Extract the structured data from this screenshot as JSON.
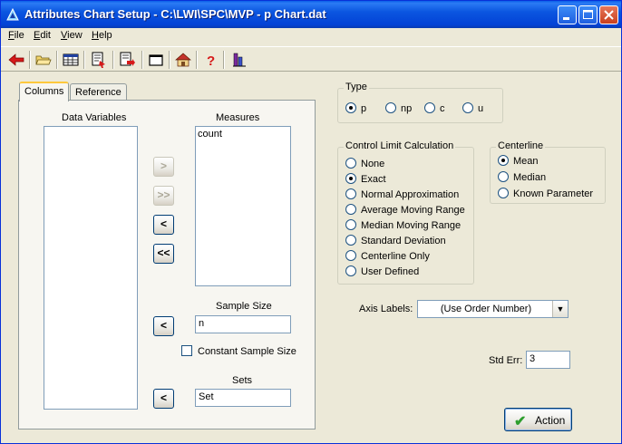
{
  "window": {
    "title": "Attributes Chart Setup - C:\\LWI\\SPC\\MVP - p Chart.dat"
  },
  "menu": [
    {
      "label": "File",
      "hotkey": "F",
      "rest": "ile"
    },
    {
      "label": "Edit",
      "hotkey": "E",
      "rest": "dit"
    },
    {
      "label": "View",
      "hotkey": "V",
      "rest": "iew"
    },
    {
      "label": "Help",
      "hotkey": "H",
      "rest": "elp"
    }
  ],
  "toolbar": {
    "icons": [
      "back-arrow-icon",
      "open-folder-icon",
      "spreadsheet-icon",
      "report-icon",
      "exit-report-icon",
      "window-icon",
      "home-icon",
      "help-icon",
      "chart-icon"
    ]
  },
  "tabs": [
    {
      "label": "Columns",
      "active": true
    },
    {
      "label": "Reference",
      "active": false
    }
  ],
  "columns": {
    "data_variables_label": "Data Variables",
    "data_variables": [],
    "measures_label": "Measures",
    "measures": [
      "count"
    ],
    "buttons": {
      "add_one": ">",
      "add_all": ">>",
      "remove_one": "<",
      "remove_all": "<<",
      "sample_size_btn": "<",
      "sets_btn": "<"
    },
    "sample_size_label": "Sample Size",
    "sample_size_value": "n",
    "constant_sample_size_label": "Constant Sample Size",
    "sets_label": "Sets",
    "sets_value": "Set"
  },
  "type_group": {
    "title": "Type",
    "options": [
      "p",
      "np",
      "c",
      "u"
    ],
    "selected": "p"
  },
  "control_limit": {
    "title": "Control Limit Calculation",
    "options": [
      "None",
      "Exact",
      "Normal Approximation",
      "Average Moving Range",
      "Median Moving Range",
      "Standard Deviation",
      "Centerline Only",
      "User Defined"
    ],
    "selected": "Exact"
  },
  "centerline": {
    "title": "Centerline",
    "options": [
      "Mean",
      "Median",
      "Known Parameter"
    ],
    "selected": "Mean"
  },
  "axis_labels": {
    "label": "Axis Labels:",
    "value": "(Use Order Number)"
  },
  "std_err": {
    "label": "Std Err:",
    "value": "3"
  },
  "action_button": {
    "label": "Action"
  },
  "colors": {
    "titlebar": "#0A5FE8",
    "face": "#ECE9D8",
    "accent_green": "#21A121"
  }
}
